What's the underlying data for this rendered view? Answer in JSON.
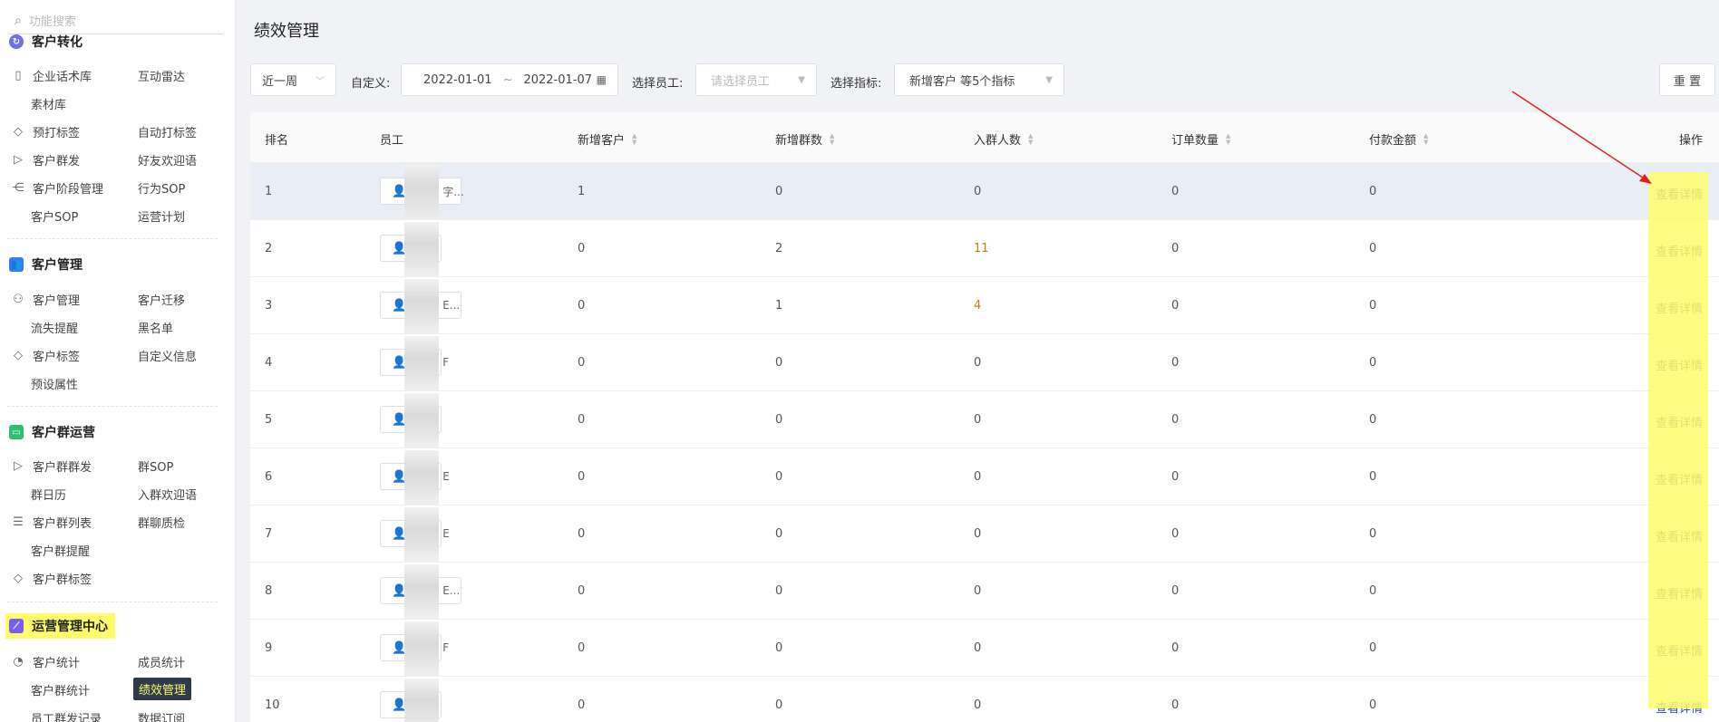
{
  "sidebar": {
    "search_placeholder": "功能搜索",
    "sections": [
      {
        "title": "客户转化"
      },
      {
        "title": "客户管理"
      },
      {
        "title": "客户群运营"
      },
      {
        "title": "运营管理中心"
      }
    ],
    "items": {
      "qyhsk": "企业话术库",
      "hdld": "互动雷达",
      "sck": "素材库",
      "ydbq": "预打标签",
      "zddbq": "自动打标签",
      "khqf": "客户群发",
      "hyhyy": "好友欢迎语",
      "khjdgl": "客户阶段管理",
      "xwsop": "行为SOP",
      "khsop": "客户SOP",
      "yyjh": "运营计划",
      "khgl": "客户管理",
      "khqy": "客户迁移",
      "lstx": "流失提醒",
      "hmd": "黑名单",
      "khbq": "客户标签",
      "zdyxx": "自定义信息",
      "yssx": "预设属性",
      "khqqf": "客户群群发",
      "qsop": "群SOP",
      "qrl": "群日历",
      "rqhyy": "入群欢迎语",
      "khqlb": "客户群列表",
      "qlzj": "群聊质检",
      "khqtx": "客户群提醒",
      "khqbq": "客户群标签",
      "khtj": "客户统计",
      "cytj": "成员统计",
      "khqtj": "客户群统计",
      "jxgl": "绩效管理",
      "ygqfjl": "员工群发记录",
      "sjdy": "数据订阅"
    }
  },
  "page": {
    "title": "绩效管理"
  },
  "filters": {
    "period": "近一周",
    "custom_label": "自定义:",
    "date_start": "2022-01-01",
    "date_sep": "~",
    "date_end": "2022-01-07",
    "staff_label": "选择员工:",
    "staff_placeholder": "请选择员工",
    "metric_label": "选择指标:",
    "metric_value": "新增客户 等5个指标",
    "reset": "重 置"
  },
  "table": {
    "headers": {
      "rank": "排名",
      "staff": "员工",
      "new_customers": "新增客户",
      "new_groups": "新增群数",
      "joined": "入群人数",
      "orders": "订单数量",
      "payment": "付款金额",
      "action": "操作"
    },
    "action_label": "查看详情",
    "rows": [
      {
        "rank": "1",
        "staff_suffix": "字...",
        "c1": "1",
        "c2": "0",
        "c3": "0",
        "c4": "0",
        "c5": "0"
      },
      {
        "rank": "2",
        "staff_suffix": "",
        "c1": "0",
        "c2": "2",
        "c3": "11",
        "c4": "0",
        "c5": "0"
      },
      {
        "rank": "3",
        "staff_suffix": "E...",
        "c1": "0",
        "c2": "1",
        "c3": "4",
        "c4": "0",
        "c5": "0"
      },
      {
        "rank": "4",
        "staff_suffix": "F",
        "c1": "0",
        "c2": "0",
        "c3": "0",
        "c4": "0",
        "c5": "0"
      },
      {
        "rank": "5",
        "staff_suffix": "",
        "c1": "0",
        "c2": "0",
        "c3": "0",
        "c4": "0",
        "c5": "0"
      },
      {
        "rank": "6",
        "staff_suffix": "E",
        "c1": "0",
        "c2": "0",
        "c3": "0",
        "c4": "0",
        "c5": "0"
      },
      {
        "rank": "7",
        "staff_suffix": "E",
        "c1": "0",
        "c2": "0",
        "c3": "0",
        "c4": "0",
        "c5": "0"
      },
      {
        "rank": "8",
        "staff_suffix": "E...",
        "c1": "0",
        "c2": "0",
        "c3": "0",
        "c4": "0",
        "c5": "0"
      },
      {
        "rank": "9",
        "staff_suffix": "F",
        "c1": "0",
        "c2": "0",
        "c3": "0",
        "c4": "0",
        "c5": "0"
      },
      {
        "rank": "10",
        "staff_suffix": "",
        "c1": "0",
        "c2": "0",
        "c3": "0",
        "c4": "0",
        "c5": "0"
      }
    ]
  },
  "colors": {
    "highlight": "#fffb6b",
    "active_nav_bg": "#2f3a4a",
    "arrow": "#e02020"
  }
}
